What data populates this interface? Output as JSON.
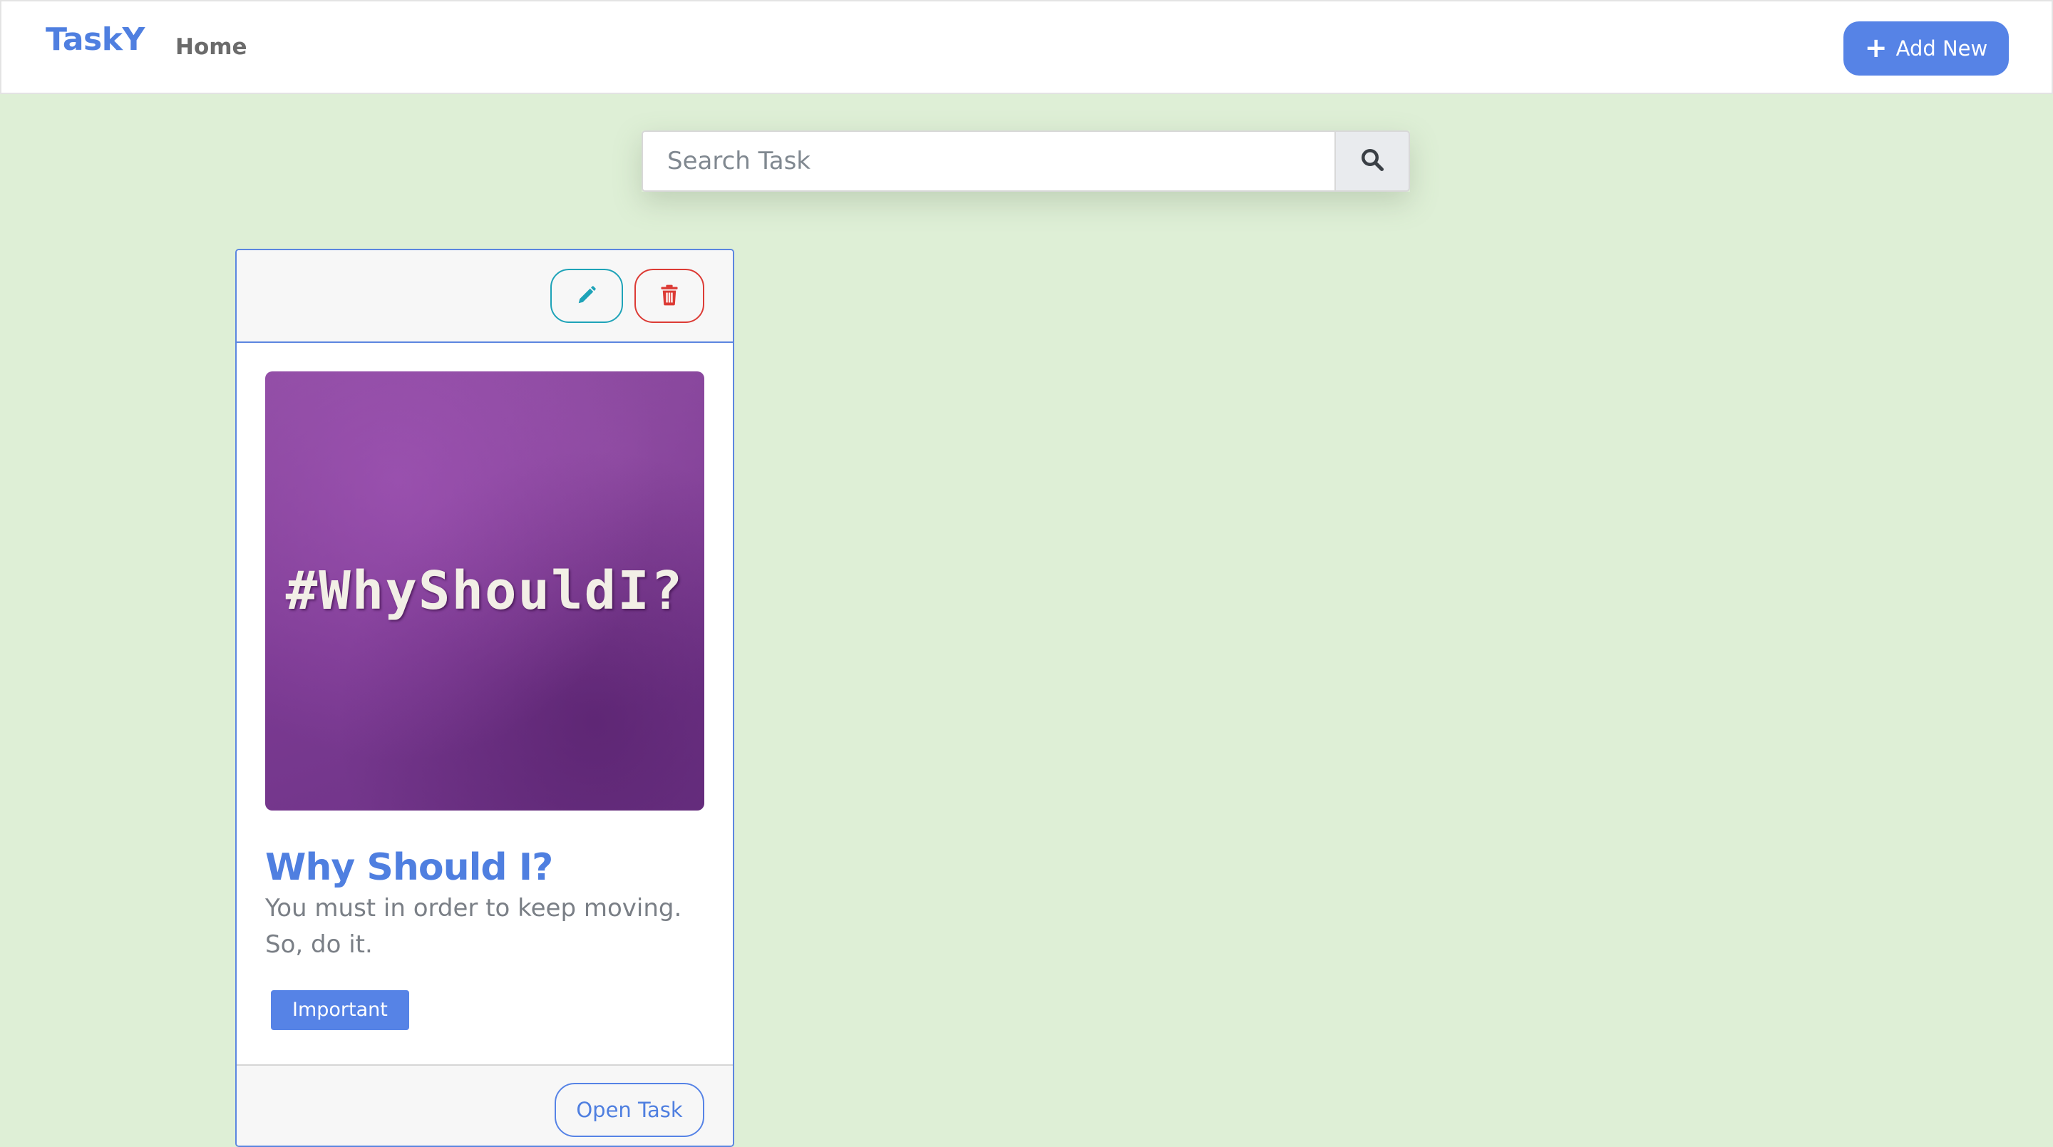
{
  "navbar": {
    "brand": "TaskY",
    "home_label": "Home",
    "add_new_label": "Add New",
    "add_new_icon": "plus-icon"
  },
  "search": {
    "placeholder": "Search Task",
    "value": "",
    "icon": "search-icon"
  },
  "tasks": [
    {
      "image_text": "#WhyShouldI?",
      "title": "Why Should I?",
      "description": "You must in order to keep moving. So, do it.",
      "tag": "Important",
      "edit_icon": "pencil-icon",
      "delete_icon": "trash-icon",
      "open_label": "Open Task"
    }
  ],
  "colors": {
    "background": "#deefd6",
    "primary": "#5683e6",
    "edit": "#1ea3b8",
    "delete": "#dc3b35",
    "image": "#8d4ca1"
  }
}
